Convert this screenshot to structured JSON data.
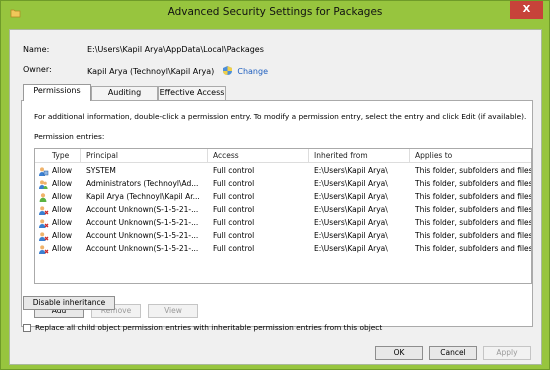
{
  "window": {
    "title": "Advanced Security Settings for Packages",
    "close_label": "X"
  },
  "meta": {
    "name_label": "Name:",
    "name_value": "E:\\Users\\Kapil Arya\\AppData\\Local\\Packages",
    "owner_label": "Owner:",
    "owner_value": "Kapil Arya (Technoyl\\Kapil Arya)",
    "change_link": "Change"
  },
  "tabs": [
    {
      "label": "Permissions",
      "active": true
    },
    {
      "label": "Auditing",
      "active": false
    },
    {
      "label": "Effective Access",
      "active": false
    }
  ],
  "panel": {
    "info_text": "For additional information, double-click a permission entry. To modify a permission entry, select the entry and click Edit (if available).",
    "entries_label": "Permission entries:"
  },
  "table": {
    "headers": [
      "Type",
      "Principal",
      "Access",
      "Inherited from",
      "Applies to"
    ],
    "rows": [
      {
        "type": "Allow",
        "principal": "SYSTEM",
        "access": "Full control",
        "inherited": "E:\\Users\\Kapil Arya\\",
        "applies": "This folder, subfolders and files",
        "icon": "system-user-icon"
      },
      {
        "type": "Allow",
        "principal": "Administrators (Technoyl\\Ad...",
        "access": "Full control",
        "inherited": "E:\\Users\\Kapil Arya\\",
        "applies": "This folder, subfolders and files",
        "icon": "group-icon"
      },
      {
        "type": "Allow",
        "principal": "Kapil Arya (Technoyl\\Kapil Ar...",
        "access": "Full control",
        "inherited": "E:\\Users\\Kapil Arya\\",
        "applies": "This folder, subfolders and files",
        "icon": "user-icon"
      },
      {
        "type": "Allow",
        "principal": "Account Unknown(S-1-5-21-...",
        "access": "Full control",
        "inherited": "E:\\Users\\Kapil Arya\\",
        "applies": "This folder, subfolders and files",
        "icon": "unknown-user-icon"
      },
      {
        "type": "Allow",
        "principal": "Account Unknown(S-1-5-21-...",
        "access": "Full control",
        "inherited": "E:\\Users\\Kapil Arya\\",
        "applies": "This folder, subfolders and files",
        "icon": "unknown-user-icon"
      },
      {
        "type": "Allow",
        "principal": "Account Unknown(S-1-5-21-...",
        "access": "Full control",
        "inherited": "E:\\Users\\Kapil Arya\\",
        "applies": "This folder, subfolders and files",
        "icon": "unknown-user-icon"
      },
      {
        "type": "Allow",
        "principal": "Account Unknown(S-1-5-21-...",
        "access": "Full control",
        "inherited": "E:\\Users\\Kapil Arya\\",
        "applies": "This folder, subfolders and files",
        "icon": "unknown-user-icon"
      }
    ]
  },
  "buttons": {
    "add": "Add",
    "remove": "Remove",
    "view": "View",
    "disable_inheritance": "Disable inheritance",
    "ok": "OK",
    "cancel": "Cancel",
    "apply": "Apply"
  },
  "replace_checkbox": {
    "label": "Replace all child object permission entries with inheritable permission entries from this object",
    "checked": false
  },
  "colors": {
    "frame": "#97c53e",
    "close": "#c7433a",
    "link": "#1f5fbf"
  }
}
